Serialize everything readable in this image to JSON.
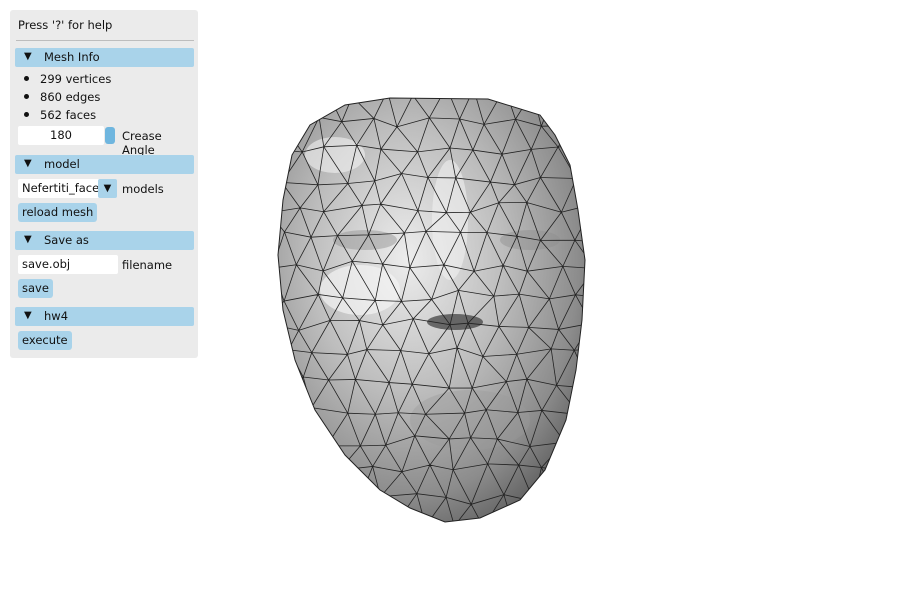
{
  "panel": {
    "help_text": "Press '?' for help",
    "mesh_info": {
      "header": "Mesh Info",
      "stats": [
        "299 vertices",
        "860 edges",
        "562 faces"
      ],
      "crease_angle_value": "180",
      "crease_angle_label": "Crease Angle"
    },
    "model": {
      "header": "model",
      "selected": "Nefertiti_face",
      "dropdown_label": "models",
      "reload_label": "reload mesh"
    },
    "save_as": {
      "header": "Save as",
      "filename_value": "save.obj",
      "filename_label": "filename",
      "save_label": "save"
    },
    "hw4": {
      "header": "hw4",
      "execute_label": "execute"
    }
  },
  "viewport": {
    "background": "#ffffff",
    "mesh_fill": "#b9b9b9",
    "wire_color": "#222222"
  }
}
